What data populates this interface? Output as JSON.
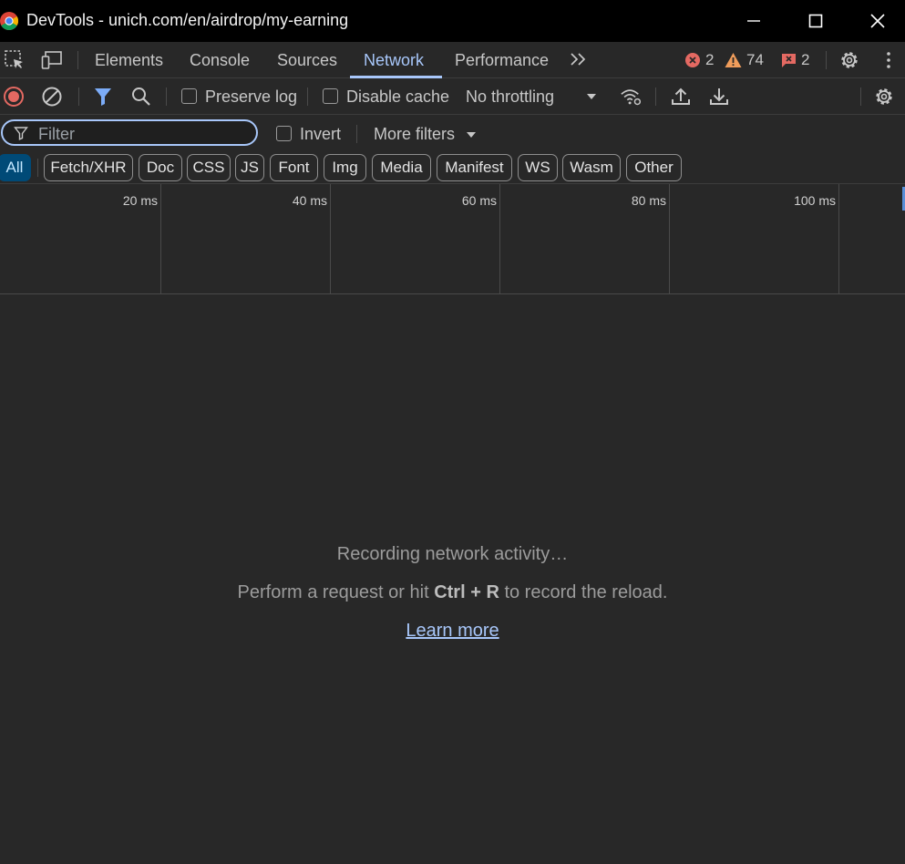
{
  "window": {
    "title": "DevTools - unich.com/en/airdrop/my-earning"
  },
  "tabs": [
    {
      "label": "Elements"
    },
    {
      "label": "Console"
    },
    {
      "label": "Sources"
    },
    {
      "label": "Network",
      "active": true
    },
    {
      "label": "Performance"
    }
  ],
  "counters": {
    "errors": "2",
    "warnings": "74",
    "issues": "2"
  },
  "toolbar": {
    "preserve_log_label": "Preserve log",
    "disable_cache_label": "Disable cache",
    "throttling_value": "No throttling"
  },
  "filter": {
    "placeholder": "Filter",
    "invert_label": "Invert",
    "more_filters_label": "More filters"
  },
  "type_chips": [
    "All",
    "Fetch/XHR",
    "Doc",
    "CSS",
    "JS",
    "Font",
    "Img",
    "Media",
    "Manifest",
    "WS",
    "Wasm",
    "Other"
  ],
  "active_chip": "All",
  "timeline": {
    "ticks": [
      "20 ms",
      "40 ms",
      "60 ms",
      "80 ms",
      "100 ms"
    ]
  },
  "empty_state": {
    "recording": "Recording network activity…",
    "hint_prefix": "Perform a request or hit ",
    "key_ctrl": "Ctrl",
    "key_plus": " + ",
    "key_r": "R",
    "hint_suffix": " to record the reload.",
    "learn_more": "Learn more"
  },
  "colors": {
    "accent": "#a8c7fa",
    "error": "#e46962",
    "warning": "#f09d5b",
    "record": "#e46962"
  }
}
